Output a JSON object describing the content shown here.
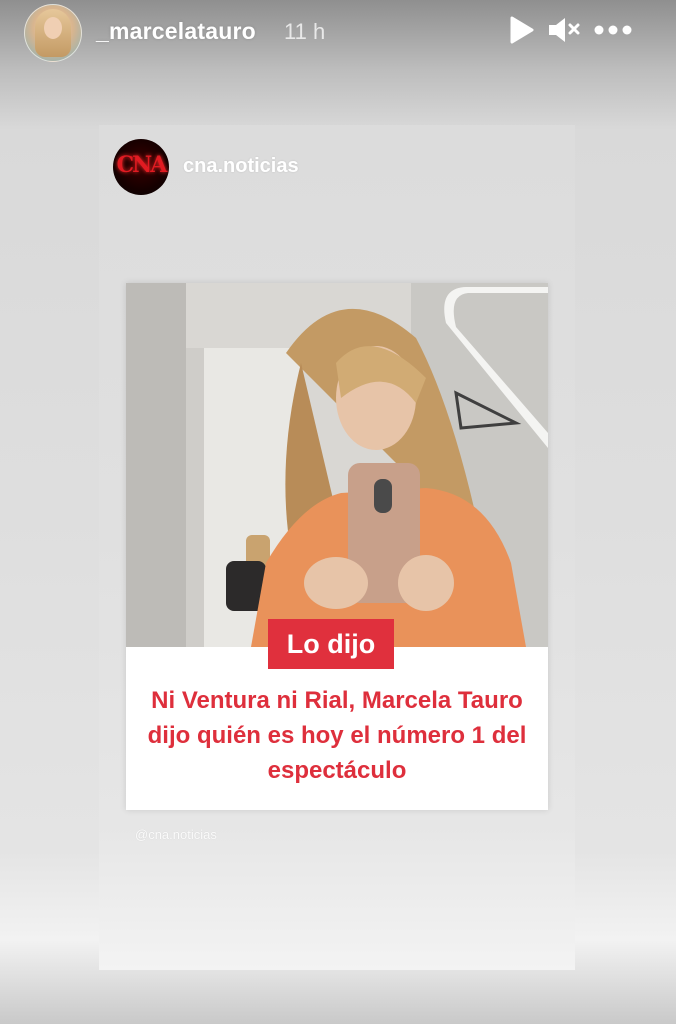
{
  "story": {
    "username": "_marcelatauro",
    "time_ago": "11 h",
    "controls": {
      "play_icon": "play-icon",
      "mute_icon": "speaker-muted-icon",
      "more_icon": "more-horizontal-icon"
    }
  },
  "shared_post": {
    "account": "cna.noticias",
    "avatar_logo_text": "CNA",
    "badge": "Lo dijo",
    "headline": "Ni Ventura ni Rial, Marcela Tauro dijo quién es hoy el número 1 del espectáculo",
    "watermark": "@cna.noticias"
  },
  "colors": {
    "headline_red": "#de2f3c",
    "badge_red": "#e0303d",
    "header_text": "#ffffff"
  }
}
